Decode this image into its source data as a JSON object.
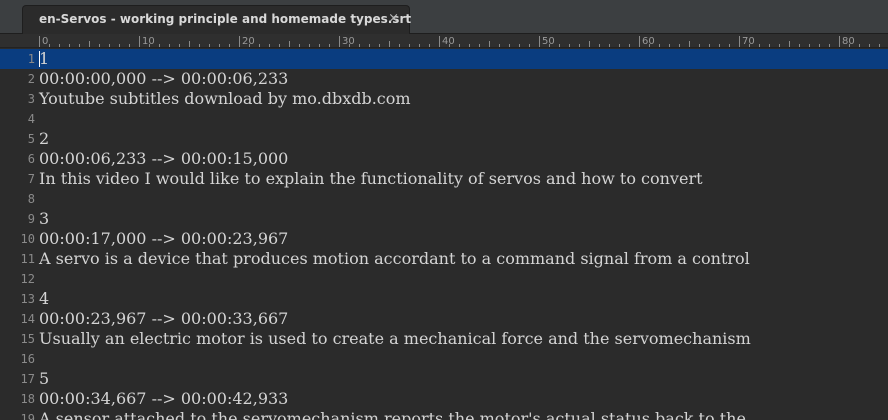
{
  "tab": {
    "title": "en-Servos - working principle and homemade types.srt",
    "close_glyph": "×"
  },
  "ruler": {
    "labels": [
      "0",
      "10",
      "20",
      "30",
      "40",
      "50",
      "60",
      "70",
      "80"
    ]
  },
  "lines": [
    {
      "num": "1",
      "text": "1"
    },
    {
      "num": "2",
      "text": "00:00:00,000 --> 00:00:06,233"
    },
    {
      "num": "3",
      "text": "Youtube subtitles download by mo.dbxdb.com"
    },
    {
      "num": "4",
      "text": ""
    },
    {
      "num": "5",
      "text": "2"
    },
    {
      "num": "6",
      "text": "00:00:06,233 --> 00:00:15,000"
    },
    {
      "num": "7",
      "text": "In this video I would like to explain the functionality of servos and how to convert"
    },
    {
      "num": "8",
      "text": ""
    },
    {
      "num": "9",
      "text": "3"
    },
    {
      "num": "10",
      "text": "00:00:17,000 --> 00:00:23,967"
    },
    {
      "num": "11",
      "text": "A servo is a device that produces motion accordant to a command signal from a control"
    },
    {
      "num": "12",
      "text": ""
    },
    {
      "num": "13",
      "text": "4"
    },
    {
      "num": "14",
      "text": "00:00:23,967 --> 00:00:33,667"
    },
    {
      "num": "15",
      "text": "Usually an electric motor is used to create a mechanical force and the servomechanism"
    },
    {
      "num": "16",
      "text": ""
    },
    {
      "num": "17",
      "text": "5"
    },
    {
      "num": "18",
      "text": "00:00:34,667 --> 00:00:42,933"
    },
    {
      "num": "19",
      "text": "A sensor attached to the servomechanism reports the motor's actual status back to the"
    }
  ]
}
